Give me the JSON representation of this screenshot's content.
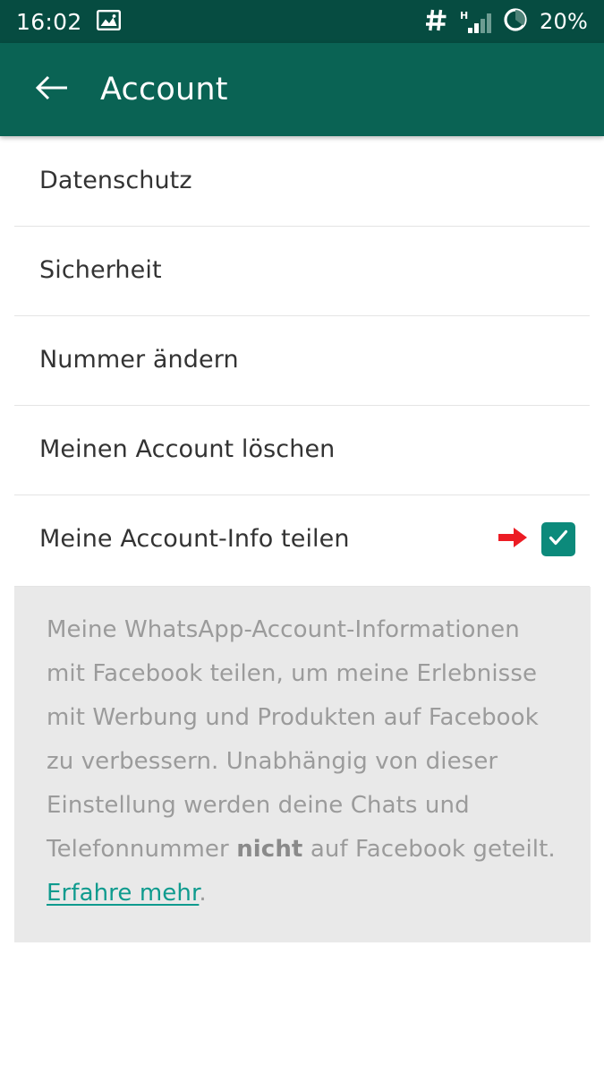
{
  "status_bar": {
    "time": "16:02",
    "photo_icon": "photo-icon",
    "hash_icon": "hash-icon",
    "signal_type": "H",
    "signal_icon": "signal-bars-icon",
    "battery_icon": "battery-circle-icon",
    "battery_percent": "20%"
  },
  "app_bar": {
    "back_icon": "back-arrow-icon",
    "title": "Account"
  },
  "settings": {
    "items": [
      {
        "label": "Datenschutz",
        "has_checkbox": false
      },
      {
        "label": "Sicherheit",
        "has_checkbox": false
      },
      {
        "label": "Nummer ändern",
        "has_checkbox": false
      },
      {
        "label": "Meinen Account löschen",
        "has_checkbox": false
      },
      {
        "label": "Meine Account-Info teilen",
        "has_checkbox": true,
        "checked": true,
        "annotation_icon": "red-arrow-icon",
        "check_icon": "checkmark-icon"
      }
    ]
  },
  "info_panel": {
    "part1": "Meine WhatsApp-Account-Informationen mit Facebook teilen, um meine Erlebnisse mit Werbung und Produkten auf Facebook zu verbessern. Unabhängig von dieser Einstellung werden deine Chats und Telefonnummer ",
    "bold": "nicht",
    "part2": " auf Facebook geteilt. ",
    "link": "Erfahre mehr",
    "part3": "."
  },
  "colors": {
    "status_bar_bg": "#064c41",
    "app_bar_bg": "#0a6354",
    "checkbox_teal": "#0c8a7b",
    "link_teal": "#0f9b8e",
    "annotation_red": "#ec1c24",
    "info_bg": "#e9e9e9",
    "divider": "#e4e4e4",
    "list_text": "#333333",
    "info_text": "#9b9b9b"
  }
}
